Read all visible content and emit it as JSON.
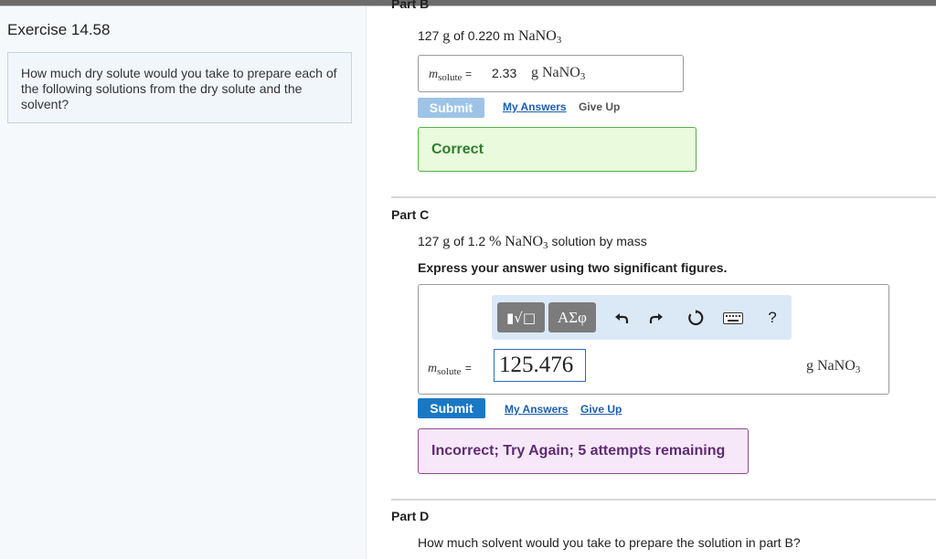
{
  "left": {
    "exercise_title": "Exercise 14.58",
    "question": "How much dry solute would you take to prepare each of the following solutions from the dry solute and the solvent?"
  },
  "partB": {
    "label": "Part B",
    "prompt_mass": "127",
    "prompt_g": "g",
    "prompt_of": "of 0.220",
    "prompt_unit": "m",
    "prompt_chem": "NaNO",
    "prompt_chem_sub": "3",
    "var": "m",
    "var_sub": "solute",
    "equals": "=",
    "answer": "2.33",
    "answer_unit": "g NaNO",
    "answer_unit_sub": "3",
    "submit_label": "Submit",
    "my_answers_label": "My Answers",
    "give_up_label": "Give Up",
    "feedback": "Correct"
  },
  "partC": {
    "label": "Part C",
    "prompt_mass": "127",
    "prompt_g": "g",
    "prompt_of": "of 1.2",
    "prompt_unit": "%",
    "prompt_chem": "NaNO",
    "prompt_chem_sub": "3",
    "prompt_tail": "solution by mass",
    "instruction": "Express your answer using two significant figures.",
    "toolbar": {
      "template_label": "▮√□",
      "symbols_label": "ΑΣφ",
      "help_label": "?"
    },
    "var": "m",
    "var_sub": "solute",
    "equals": "=",
    "input_value": "125.476",
    "answer_unit": "g NaNO",
    "answer_unit_sub": "3",
    "submit_label": "Submit",
    "my_answers_label": "My Answers",
    "give_up_label": "Give Up",
    "feedback": "Incorrect; Try Again; 5 attempts remaining"
  },
  "partD": {
    "label": "Part D",
    "prompt": "How much solvent would you take to prepare the solution in part B?"
  },
  "colors": {
    "submit_disabled": "#9dc3e6",
    "submit_active": "#1a78c2",
    "correct_bg": "#e9fbdc",
    "correct_border": "#58b04a",
    "correct_text": "#2e7d32",
    "incorrect_bg": "#f7e8f9",
    "incorrect_border": "#8e4a94",
    "incorrect_text": "#5e2b73"
  }
}
